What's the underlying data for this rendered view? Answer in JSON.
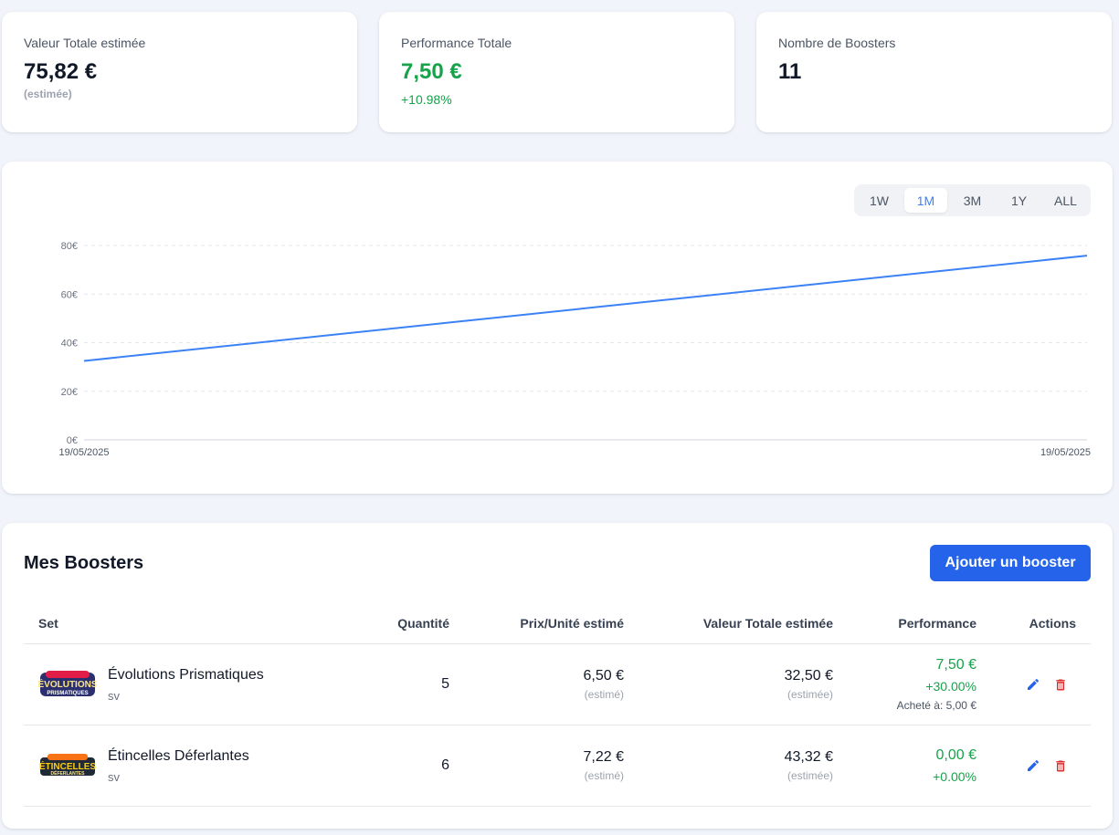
{
  "stats": {
    "total_value": {
      "label": "Valeur Totale estimée",
      "value": "75,82 €",
      "sub": "(estimée)"
    },
    "performance": {
      "label": "Performance Totale",
      "value": "7,50 €",
      "sub": "+10.98%"
    },
    "boosters_count": {
      "label": "Nombre de Boosters",
      "value": "11"
    }
  },
  "chart": {
    "range_buttons": [
      "1W",
      "1M",
      "3M",
      "1Y",
      "ALL"
    ],
    "active_range": "1M",
    "line_color": "#3b82f6"
  },
  "chart_data": {
    "type": "line",
    "x": [
      "19/05/2025",
      "19/05/2025"
    ],
    "series": [
      {
        "values": [
          32.5,
          75.82
        ]
      }
    ],
    "y_ticks": [
      "0€",
      "20€",
      "40€",
      "60€",
      "80€"
    ],
    "ylim": [
      0,
      80
    ],
    "title": "",
    "xlabel": "",
    "ylabel": "",
    "grid": true
  },
  "boosters": {
    "title": "Mes Boosters",
    "add_button": "Ajouter un booster",
    "columns": {
      "set": "Set",
      "quantity": "Quantité",
      "unit_price": "Prix/Unité estimé",
      "total_value": "Valeur Totale estimée",
      "performance": "Performance",
      "actions": "Actions"
    },
    "rows": [
      {
        "name": "Évolutions Prismatiques",
        "code": "sv",
        "logo_text": "ÉVOLUTIONS",
        "logo_sub": "PRISMATIQUES",
        "quantity": "5",
        "unit_price": "6,50 €",
        "unit_price_sub": "(estimé)",
        "total_value": "32,50 €",
        "total_value_sub": "(estimée)",
        "perf_value": "7,50 €",
        "perf_pct": "+30.00%",
        "bought": "Acheté à: 5,00 €"
      },
      {
        "name": "Étincelles Déferlantes",
        "code": "sv",
        "logo_text": "ÉTINCELLES",
        "logo_sub": "DÉFERLANTES",
        "quantity": "6",
        "unit_price": "7,22 €",
        "unit_price_sub": "(estimé)",
        "total_value": "43,32 €",
        "total_value_sub": "(estimée)",
        "perf_value": "0,00 €",
        "perf_pct": "+0.00%"
      }
    ]
  },
  "colors": {
    "accent": "#2563eb",
    "positive": "#16a34a",
    "danger": "#dc2626"
  }
}
